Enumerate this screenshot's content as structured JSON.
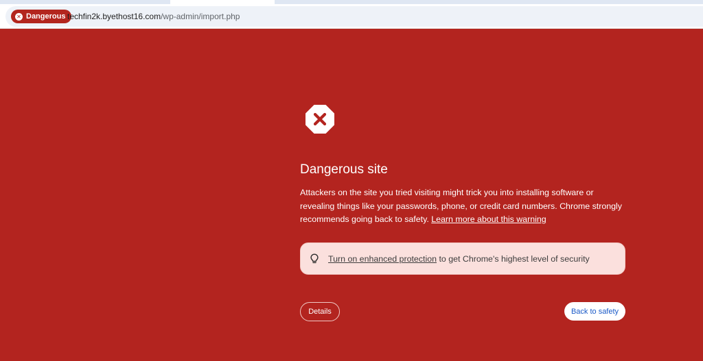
{
  "browser": {
    "security_chip": {
      "label": "Dangerous",
      "icon": "close-circle-icon",
      "color": "#b3261e"
    },
    "url": {
      "host": "techfin2k.byethost16.com",
      "path": "/wp-admin/import.php"
    }
  },
  "interstitial": {
    "background_color": "#b3241f",
    "icon": "stop-sign-x-icon",
    "title": "Dangerous site",
    "body_text": "Attackers on the site you tried visiting might trick you into installing software or revealing things like your passwords, phone, or credit card numbers. Chrome strongly recommends going back to safety.",
    "learn_more_link": "Learn more about this warning",
    "enhanced_protection": {
      "icon": "lightbulb-icon",
      "link_text": "Turn on enhanced protection",
      "text": "to get Chrome's highest level of security"
    },
    "details_button": "Details",
    "back_button": "Back to safety"
  }
}
